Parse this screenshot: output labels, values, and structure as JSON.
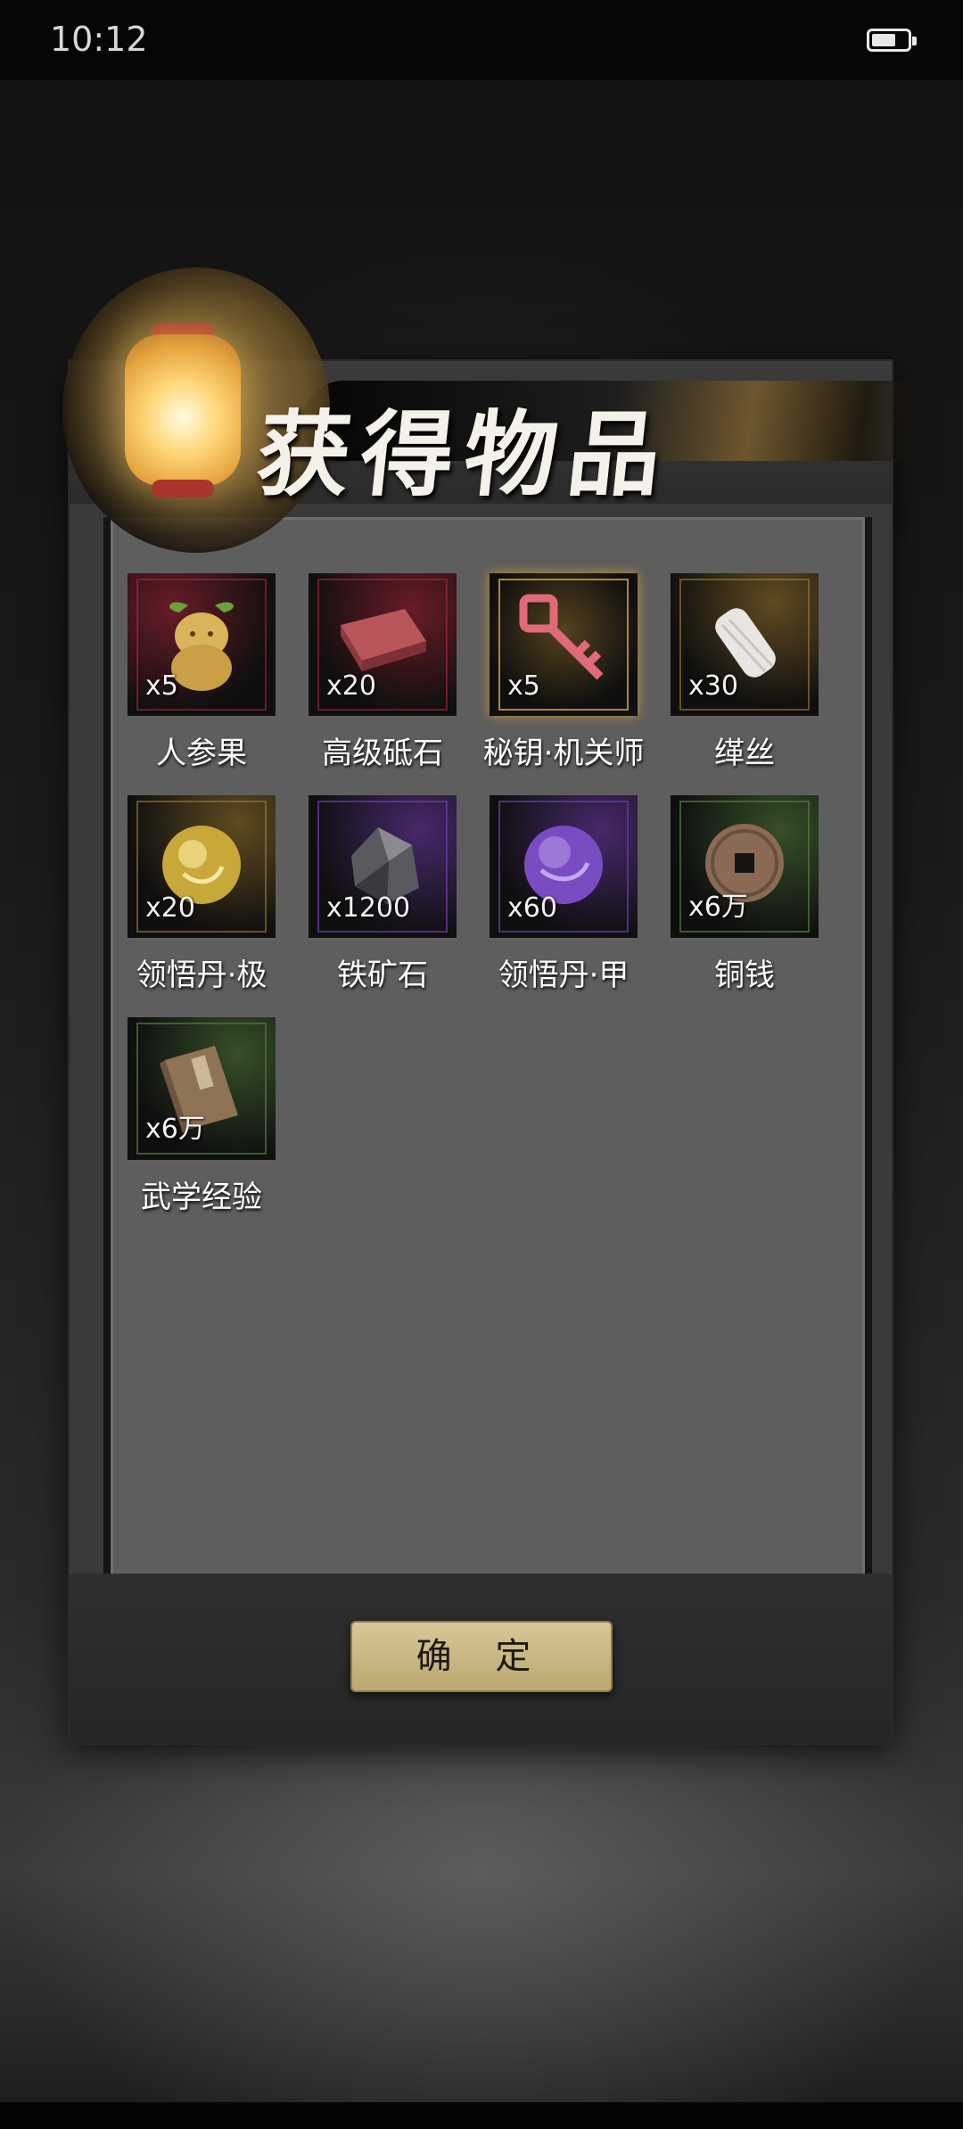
{
  "status_bar": {
    "time": "10:12"
  },
  "dialog": {
    "title": "获得物品",
    "confirm_label": "确 定",
    "items": [
      {
        "name": "人参果",
        "quantity": "x5",
        "icon": "ginseng-fruit-icon",
        "rarity_color": "#b3263a"
      },
      {
        "name": "高级砥石",
        "quantity": "x20",
        "icon": "whetstone-icon",
        "rarity_color": "#b3263a"
      },
      {
        "name": "秘钥·机关师",
        "quantity": "x5",
        "icon": "key-icon",
        "rarity_color": "#d8a13a"
      },
      {
        "name": "缂丝",
        "quantity": "x30",
        "icon": "silk-spool-icon",
        "rarity_color": "#a27c2e"
      },
      {
        "name": "领悟丹·极",
        "quantity": "x20",
        "icon": "gold-pill-icon",
        "rarity_color": "#a27c2e"
      },
      {
        "name": "铁矿石",
        "quantity": "x1200",
        "icon": "iron-ore-icon",
        "rarity_color": "#6b3aa8"
      },
      {
        "name": "领悟丹·甲",
        "quantity": "x60",
        "icon": "purple-pill-icon",
        "rarity_color": "#6b3aa8"
      },
      {
        "name": "铜钱",
        "quantity": "x6万",
        "icon": "copper-coin-icon",
        "rarity_color": "#4f7a3a"
      },
      {
        "name": "武学经验",
        "quantity": "x6万",
        "icon": "martial-book-icon",
        "rarity_color": "#4f7a3a"
      }
    ]
  }
}
